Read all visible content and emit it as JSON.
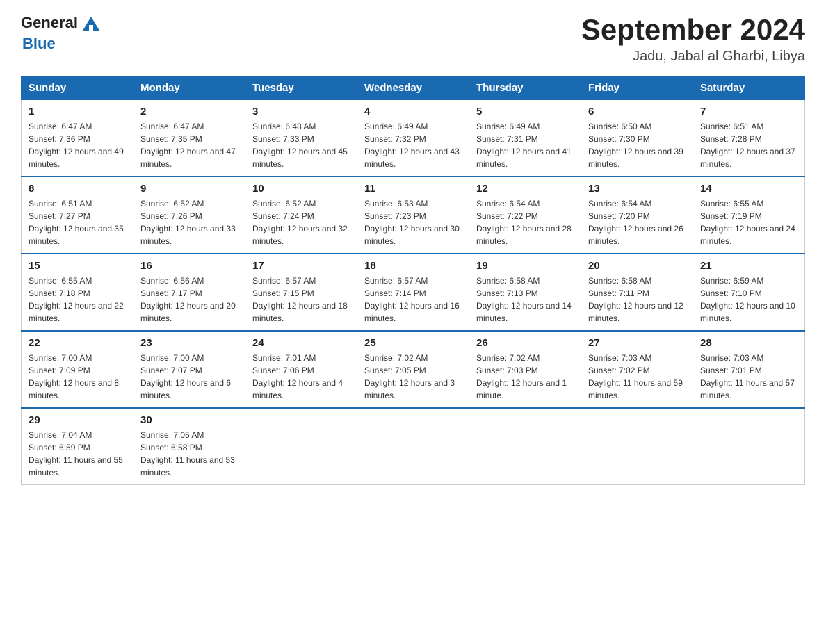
{
  "header": {
    "logo_general": "General",
    "logo_blue": "Blue",
    "month_title": "September 2024",
    "location": "Jadu, Jabal al Gharbi, Libya"
  },
  "days_of_week": [
    "Sunday",
    "Monday",
    "Tuesday",
    "Wednesday",
    "Thursday",
    "Friday",
    "Saturday"
  ],
  "weeks": [
    [
      {
        "day": "1",
        "sunrise": "6:47 AM",
        "sunset": "7:36 PM",
        "daylight": "12 hours and 49 minutes."
      },
      {
        "day": "2",
        "sunrise": "6:47 AM",
        "sunset": "7:35 PM",
        "daylight": "12 hours and 47 minutes."
      },
      {
        "day": "3",
        "sunrise": "6:48 AM",
        "sunset": "7:33 PM",
        "daylight": "12 hours and 45 minutes."
      },
      {
        "day": "4",
        "sunrise": "6:49 AM",
        "sunset": "7:32 PM",
        "daylight": "12 hours and 43 minutes."
      },
      {
        "day": "5",
        "sunrise": "6:49 AM",
        "sunset": "7:31 PM",
        "daylight": "12 hours and 41 minutes."
      },
      {
        "day": "6",
        "sunrise": "6:50 AM",
        "sunset": "7:30 PM",
        "daylight": "12 hours and 39 minutes."
      },
      {
        "day": "7",
        "sunrise": "6:51 AM",
        "sunset": "7:28 PM",
        "daylight": "12 hours and 37 minutes."
      }
    ],
    [
      {
        "day": "8",
        "sunrise": "6:51 AM",
        "sunset": "7:27 PM",
        "daylight": "12 hours and 35 minutes."
      },
      {
        "day": "9",
        "sunrise": "6:52 AM",
        "sunset": "7:26 PM",
        "daylight": "12 hours and 33 minutes."
      },
      {
        "day": "10",
        "sunrise": "6:52 AM",
        "sunset": "7:24 PM",
        "daylight": "12 hours and 32 minutes."
      },
      {
        "day": "11",
        "sunrise": "6:53 AM",
        "sunset": "7:23 PM",
        "daylight": "12 hours and 30 minutes."
      },
      {
        "day": "12",
        "sunrise": "6:54 AM",
        "sunset": "7:22 PM",
        "daylight": "12 hours and 28 minutes."
      },
      {
        "day": "13",
        "sunrise": "6:54 AM",
        "sunset": "7:20 PM",
        "daylight": "12 hours and 26 minutes."
      },
      {
        "day": "14",
        "sunrise": "6:55 AM",
        "sunset": "7:19 PM",
        "daylight": "12 hours and 24 minutes."
      }
    ],
    [
      {
        "day": "15",
        "sunrise": "6:55 AM",
        "sunset": "7:18 PM",
        "daylight": "12 hours and 22 minutes."
      },
      {
        "day": "16",
        "sunrise": "6:56 AM",
        "sunset": "7:17 PM",
        "daylight": "12 hours and 20 minutes."
      },
      {
        "day": "17",
        "sunrise": "6:57 AM",
        "sunset": "7:15 PM",
        "daylight": "12 hours and 18 minutes."
      },
      {
        "day": "18",
        "sunrise": "6:57 AM",
        "sunset": "7:14 PM",
        "daylight": "12 hours and 16 minutes."
      },
      {
        "day": "19",
        "sunrise": "6:58 AM",
        "sunset": "7:13 PM",
        "daylight": "12 hours and 14 minutes."
      },
      {
        "day": "20",
        "sunrise": "6:58 AM",
        "sunset": "7:11 PM",
        "daylight": "12 hours and 12 minutes."
      },
      {
        "day": "21",
        "sunrise": "6:59 AM",
        "sunset": "7:10 PM",
        "daylight": "12 hours and 10 minutes."
      }
    ],
    [
      {
        "day": "22",
        "sunrise": "7:00 AM",
        "sunset": "7:09 PM",
        "daylight": "12 hours and 8 minutes."
      },
      {
        "day": "23",
        "sunrise": "7:00 AM",
        "sunset": "7:07 PM",
        "daylight": "12 hours and 6 minutes."
      },
      {
        "day": "24",
        "sunrise": "7:01 AM",
        "sunset": "7:06 PM",
        "daylight": "12 hours and 4 minutes."
      },
      {
        "day": "25",
        "sunrise": "7:02 AM",
        "sunset": "7:05 PM",
        "daylight": "12 hours and 3 minutes."
      },
      {
        "day": "26",
        "sunrise": "7:02 AM",
        "sunset": "7:03 PM",
        "daylight": "12 hours and 1 minute."
      },
      {
        "day": "27",
        "sunrise": "7:03 AM",
        "sunset": "7:02 PM",
        "daylight": "11 hours and 59 minutes."
      },
      {
        "day": "28",
        "sunrise": "7:03 AM",
        "sunset": "7:01 PM",
        "daylight": "11 hours and 57 minutes."
      }
    ],
    [
      {
        "day": "29",
        "sunrise": "7:04 AM",
        "sunset": "6:59 PM",
        "daylight": "11 hours and 55 minutes."
      },
      {
        "day": "30",
        "sunrise": "7:05 AM",
        "sunset": "6:58 PM",
        "daylight": "11 hours and 53 minutes."
      },
      null,
      null,
      null,
      null,
      null
    ]
  ]
}
